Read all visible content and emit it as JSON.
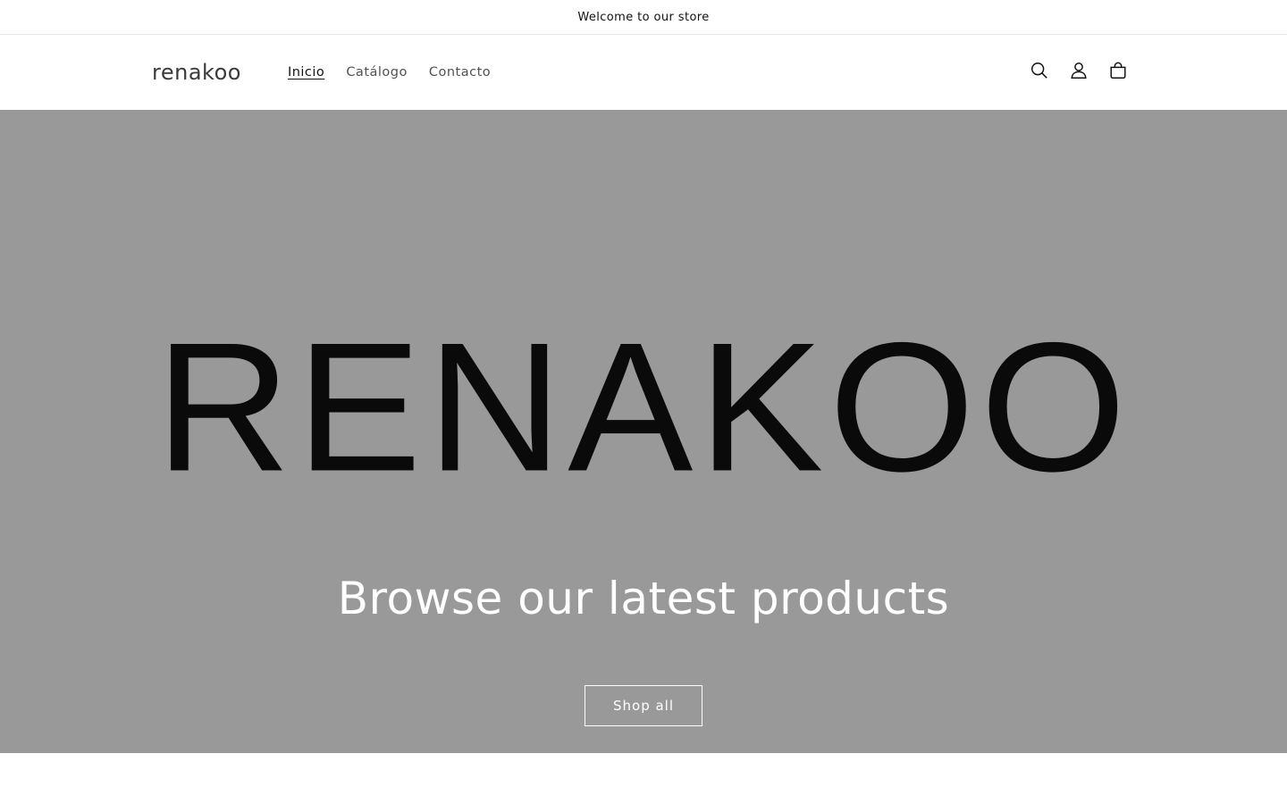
{
  "announcement": {
    "text": "Welcome to our store"
  },
  "header": {
    "logo": "renakoo",
    "nav": [
      {
        "label": "Inicio",
        "active": true
      },
      {
        "label": "Catálogo",
        "active": false
      },
      {
        "label": "Contacto",
        "active": false
      }
    ],
    "icons": [
      "search-icon",
      "account-icon",
      "cart-icon"
    ]
  },
  "hero": {
    "brand_image_text": "RENAKOO",
    "heading": "Browse our latest products",
    "button_label": "Shop all",
    "background_color": "#999999"
  }
}
